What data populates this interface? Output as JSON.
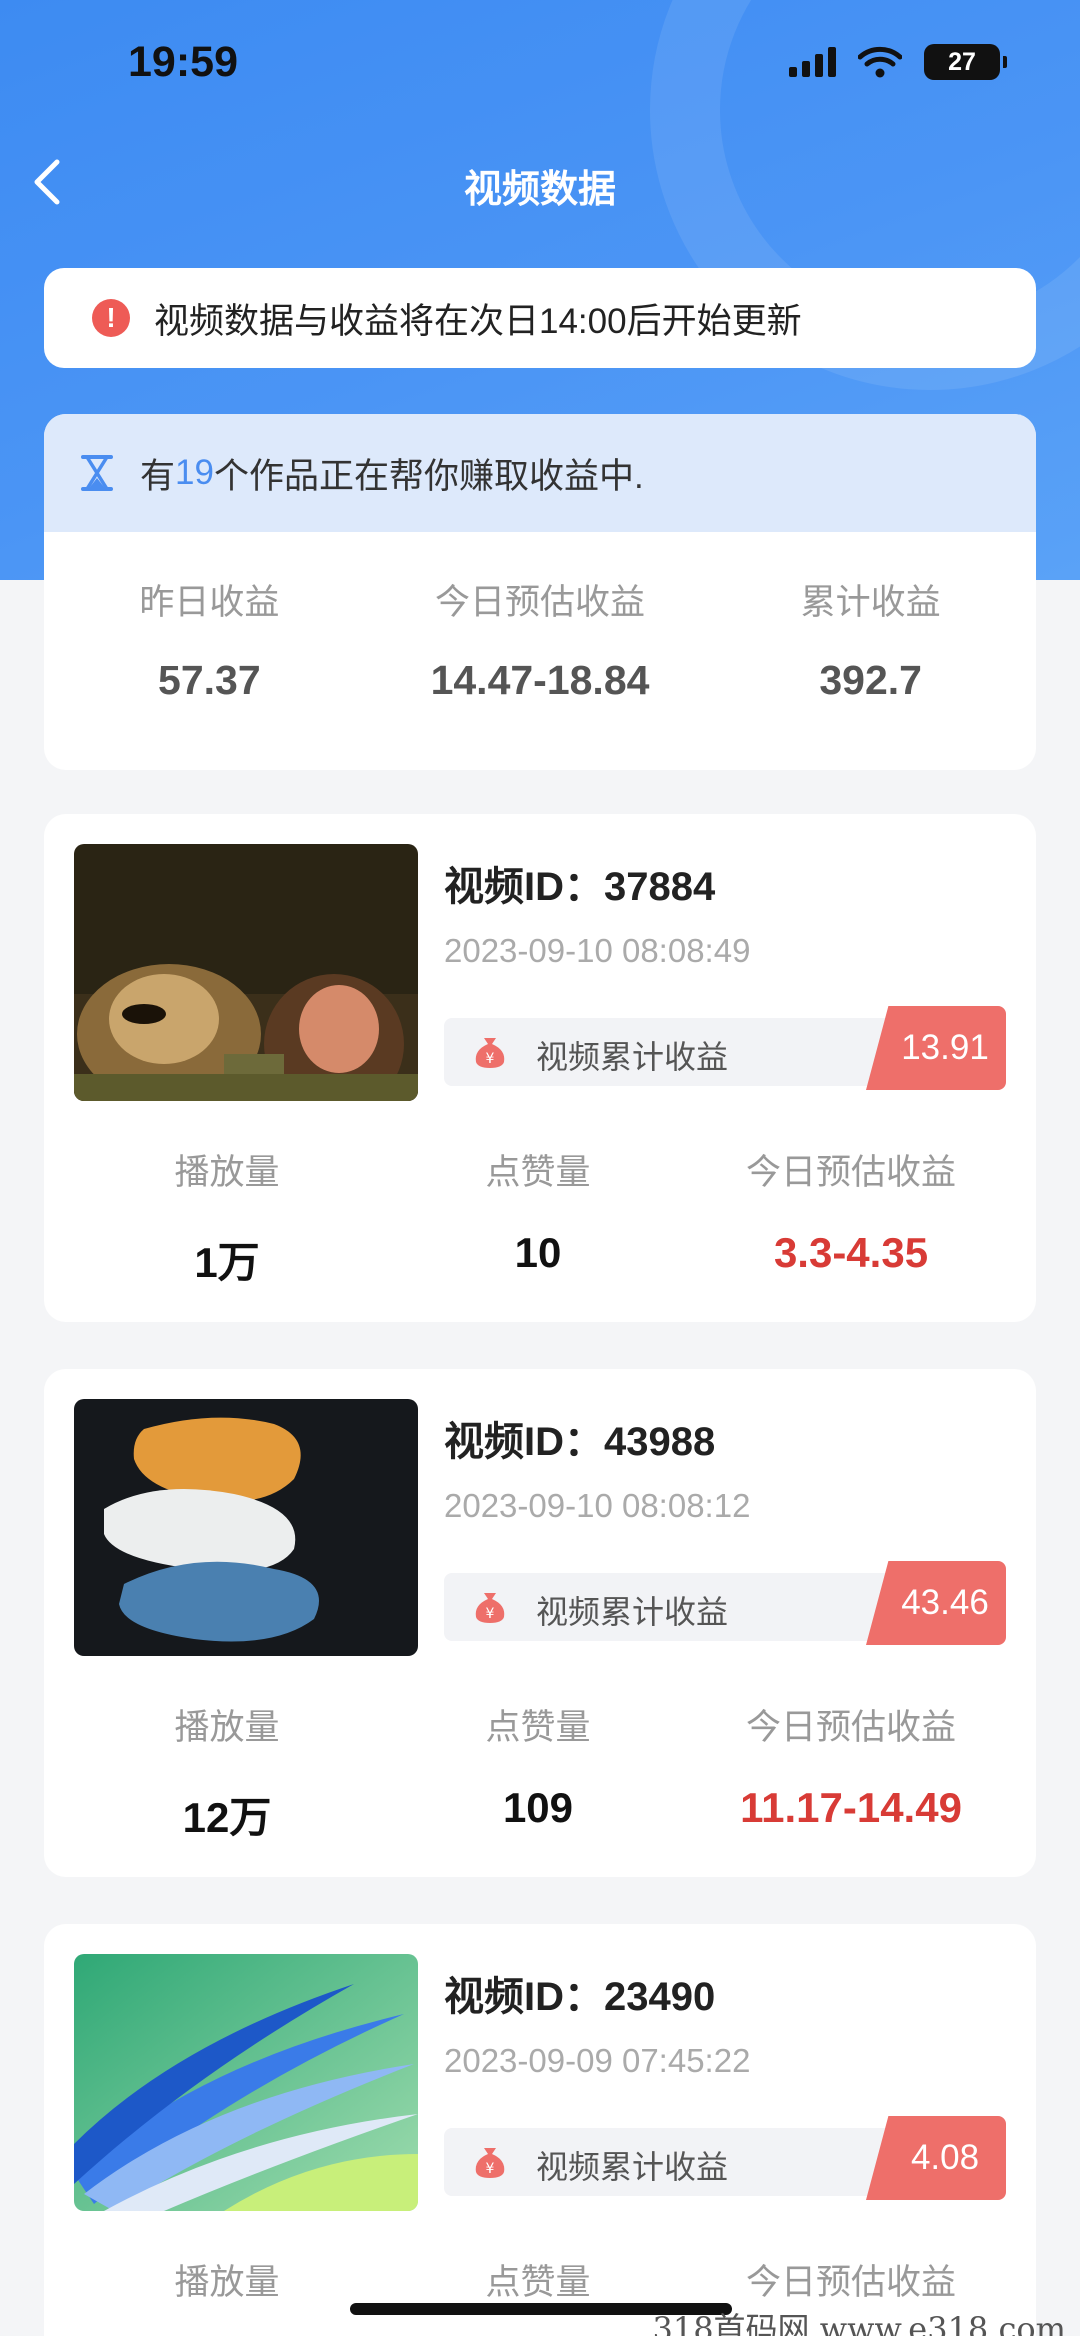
{
  "status_bar": {
    "time": "19:59",
    "battery": "27"
  },
  "nav": {
    "title": "视频数据"
  },
  "notice": {
    "text": "视频数据与收益将在次日14:00后开始更新"
  },
  "summary": {
    "prefix": "有",
    "count": "19",
    "suffix": "个作品正在帮你赚取收益中.",
    "items": [
      {
        "label": "昨日收益",
        "value": "57.37"
      },
      {
        "label": "今日预估收益",
        "value": "14.47-18.84"
      },
      {
        "label": "累计收益",
        "value": "392.7"
      }
    ]
  },
  "videos": [
    {
      "title": "视频ID：37884",
      "date": "2023-09-10 08:08:49",
      "earn_label": "视频累计收益",
      "earn_value": "13.91",
      "stats": [
        {
          "label": "播放量",
          "value": "1万"
        },
        {
          "label": "点赞量",
          "value": "10"
        },
        {
          "label": "今日预估收益",
          "value": "3.3-4.35"
        }
      ]
    },
    {
      "title": "视频ID：43988",
      "date": "2023-09-10 08:08:12",
      "earn_label": "视频累计收益",
      "earn_value": "43.46",
      "stats": [
        {
          "label": "播放量",
          "value": "12万"
        },
        {
          "label": "点赞量",
          "value": "109"
        },
        {
          "label": "今日预估收益",
          "value": "11.17-14.49"
        }
      ]
    },
    {
      "title": "视频ID：23490",
      "date": "2023-09-09 07:45:22",
      "earn_label": "视频累计收益",
      "earn_value": "4.08",
      "stats": [
        {
          "label": "播放量"
        },
        {
          "label": "点赞量"
        },
        {
          "label": "今日预估收益"
        }
      ]
    }
  ],
  "watermark": "318首码网  www.e318.com",
  "colors": {
    "primary": "#4a8df0",
    "accent_red": "#d83b36",
    "tag_red": "#ee6f6a",
    "warn": "#ee5b56"
  }
}
